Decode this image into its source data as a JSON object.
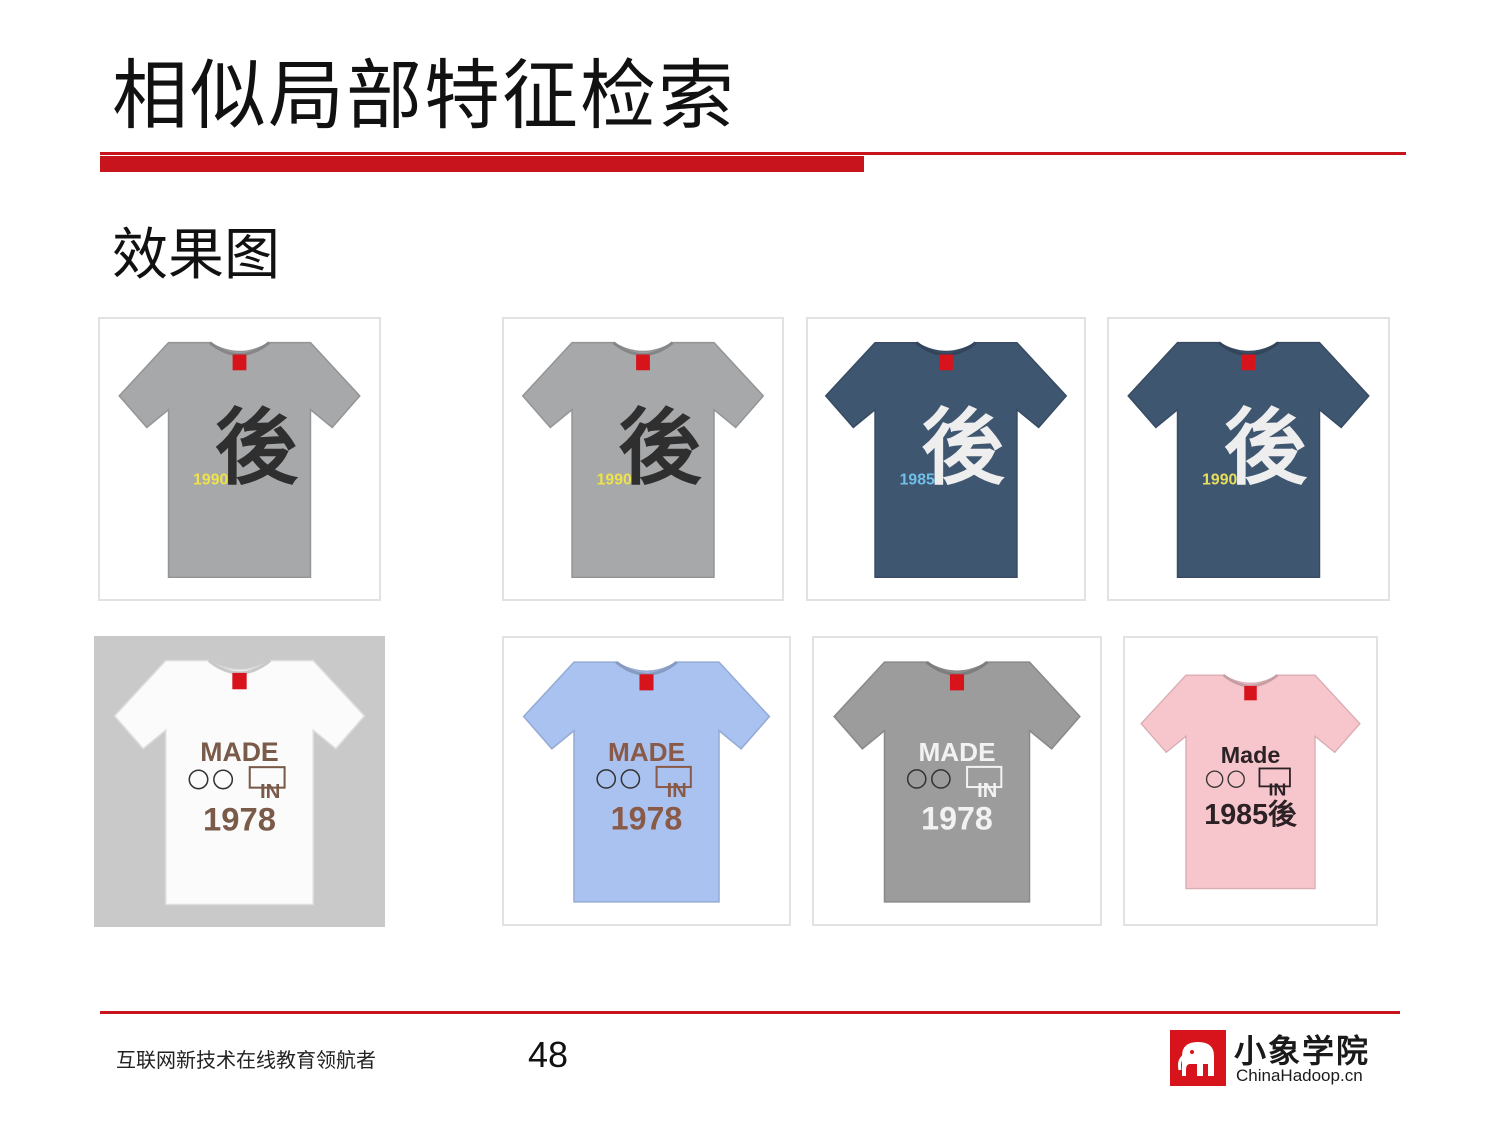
{
  "slide": {
    "title": "相似局部特征检索",
    "subtitle": "效果图",
    "accent_color": "#c8141c"
  },
  "results": {
    "row1": [
      {
        "role": "query",
        "shirt_color": "#a6a8aa",
        "print": "han",
        "char": "後",
        "year": "1990",
        "year_color": "#f0e24a"
      },
      {
        "role": "match",
        "shirt_color": "#a6a8aa",
        "print": "han",
        "char": "後",
        "year": "1990",
        "year_color": "#f0e24a"
      },
      {
        "role": "match",
        "shirt_color": "#3f5670",
        "print": "han",
        "char": "後",
        "year": "1985",
        "year_color": "#6fc0e8"
      },
      {
        "role": "match",
        "shirt_color": "#3f5670",
        "print": "han",
        "char": "後",
        "year": "1990",
        "year_color": "#e8df5a"
      }
    ],
    "row2": [
      {
        "role": "query",
        "shirt_color": "#fbfbfb",
        "print": "made",
        "line1": "MADE",
        "line2": "IN",
        "line3": "1978",
        "ink": "#7a5a48"
      },
      {
        "role": "match",
        "shirt_color": "#a9c2f0",
        "print": "made",
        "line1": "MADE",
        "line2": "IN",
        "line3": "1978",
        "ink": "#8a5a48"
      },
      {
        "role": "match",
        "shirt_color": "#9c9c9c",
        "print": "made",
        "line1": "MADE",
        "line2": "IN",
        "line3": "1978",
        "ink": "#f2f2f2"
      },
      {
        "role": "match",
        "shirt_color": "#f6c6cc",
        "print": "made",
        "line1": "Made",
        "line2": "IN",
        "line3": "1985後",
        "ink": "#2c2226"
      }
    ]
  },
  "footer": {
    "slogan": "互联网新技术在线教育领航者",
    "page_number": "48",
    "logo_name": "小象学院",
    "logo_site": "ChinaHadoop.cn",
    "logo_icon": "elephant-icon"
  }
}
